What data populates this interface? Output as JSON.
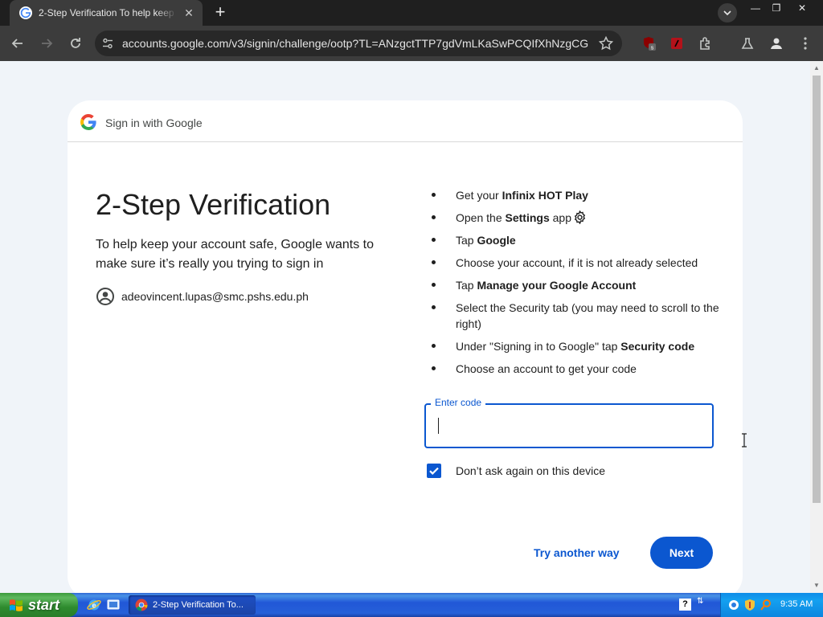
{
  "browser": {
    "tab_title": "2-Step Verification To help keep yo",
    "tab_close": "✕",
    "new_tab": "+",
    "url": "accounts.google.com/v3/signin/challenge/ootp?TL=ANzgctTTP7gdVmLKaSwPCQIfXhNzgCG...",
    "window_controls": [
      "—",
      "❐",
      "✕"
    ]
  },
  "card": {
    "header": "Sign in with Google",
    "title": "2-Step Verification",
    "subtitle": "To help keep your account safe, Google wants to make sure it’s really you trying to sign in",
    "email": "adeovincent.lupas@smc.pshs.edu.ph"
  },
  "steps": [
    {
      "text": "Get your ",
      "bold": "Infinix HOT Play",
      "after": ""
    },
    {
      "text": "Open the ",
      "bold": "Settings",
      "after": " app"
    },
    {
      "text": "Tap ",
      "bold": "Google",
      "after": ""
    },
    {
      "text": "Choose your account, if it is not already selected",
      "bold": "",
      "after": ""
    },
    {
      "text": "Tap ",
      "bold": "Manage your Google Account",
      "after": ""
    },
    {
      "text": "Select the Security tab (you may need to scroll to the right)",
      "bold": "",
      "after": ""
    },
    {
      "text": "Under \"Signing in to Google\" tap ",
      "bold": "Security code",
      "after": ""
    },
    {
      "text": "Choose an account to get your code",
      "bold": "",
      "after": ""
    }
  ],
  "code_input": {
    "label": "Enter code",
    "value": ""
  },
  "remember": {
    "label": "Don’t ask again on this device",
    "checked": true
  },
  "actions": {
    "try_another": "Try another way",
    "next": "Next"
  },
  "taskbar": {
    "start": "start",
    "task": "2-Step Verification To...",
    "help": "?",
    "clock": "9:35 AM"
  },
  "colors": {
    "primary": "#0b57d0",
    "page_bg": "#f0f4f9"
  }
}
